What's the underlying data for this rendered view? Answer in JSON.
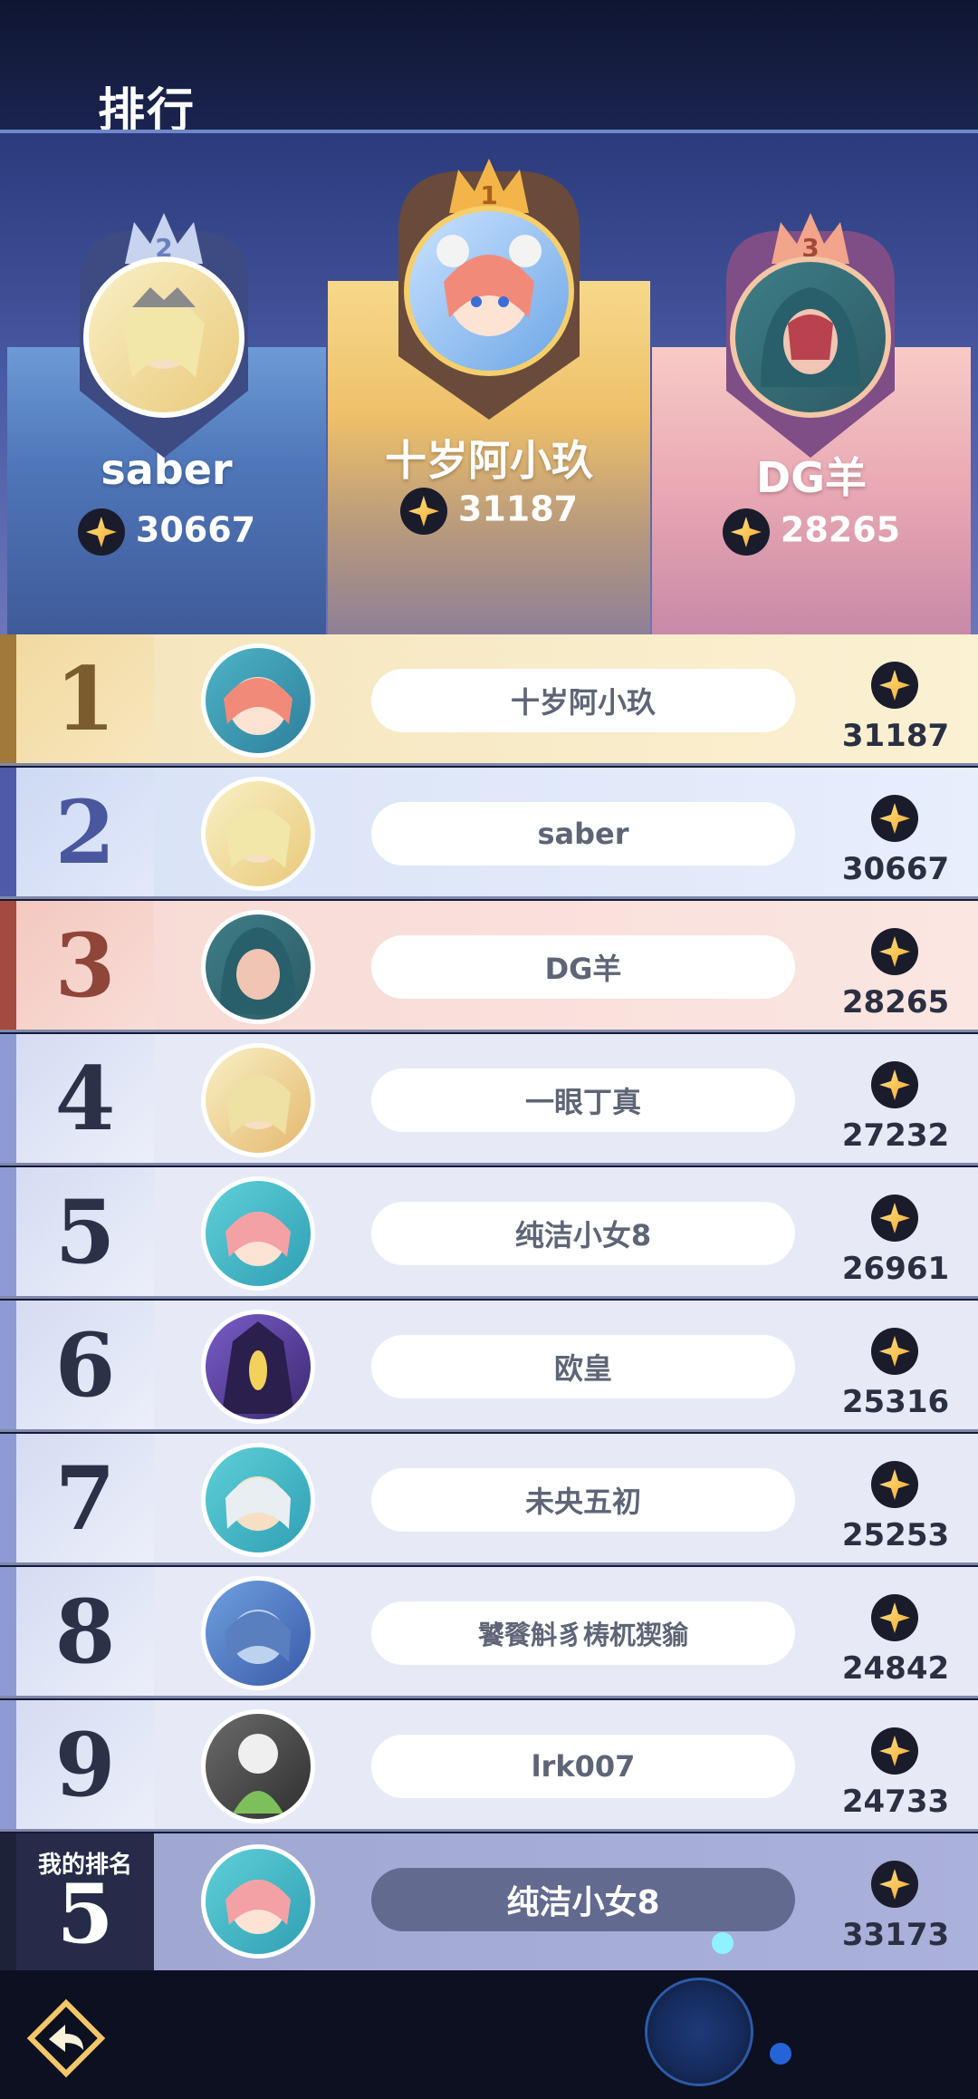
{
  "header": {
    "title": "排行"
  },
  "podium": [
    {
      "rank_badge": "2",
      "name": "saber",
      "score": "30667"
    },
    {
      "rank_badge": "1",
      "name": "十岁阿小玖",
      "score": "31187"
    },
    {
      "rank_badge": "3",
      "name": "DG羊",
      "score": "28265"
    }
  ],
  "rows": [
    {
      "rank": "1",
      "name": "十岁阿小玖",
      "score": "31187"
    },
    {
      "rank": "2",
      "name": "saber",
      "score": "30667"
    },
    {
      "rank": "3",
      "name": "DG羊",
      "score": "28265"
    },
    {
      "rank": "4",
      "name": "一眼丁真",
      "score": "27232"
    },
    {
      "rank": "5",
      "name": "纯洁小女8",
      "score": "26961"
    },
    {
      "rank": "6",
      "name": "欧皇",
      "score": "25316"
    },
    {
      "rank": "7",
      "name": "未央五初",
      "score": "25253"
    },
    {
      "rank": "8",
      "name": "饕餮斛豸梼杌猰貐",
      "score": "24842"
    },
    {
      "rank": "9",
      "name": "lrk007",
      "score": "24733"
    }
  ],
  "self": {
    "label": "我的排名",
    "rank": "5",
    "name": "纯洁小女8",
    "score": "33173"
  },
  "colors": {
    "gold": "#f6d98b",
    "blue": "#6d9bd7",
    "pink": "#e9a8b3",
    "row_default": "#e7eaf6"
  },
  "icons": [
    "gem-icon",
    "back-arrow-icon",
    "crown-icon"
  ]
}
